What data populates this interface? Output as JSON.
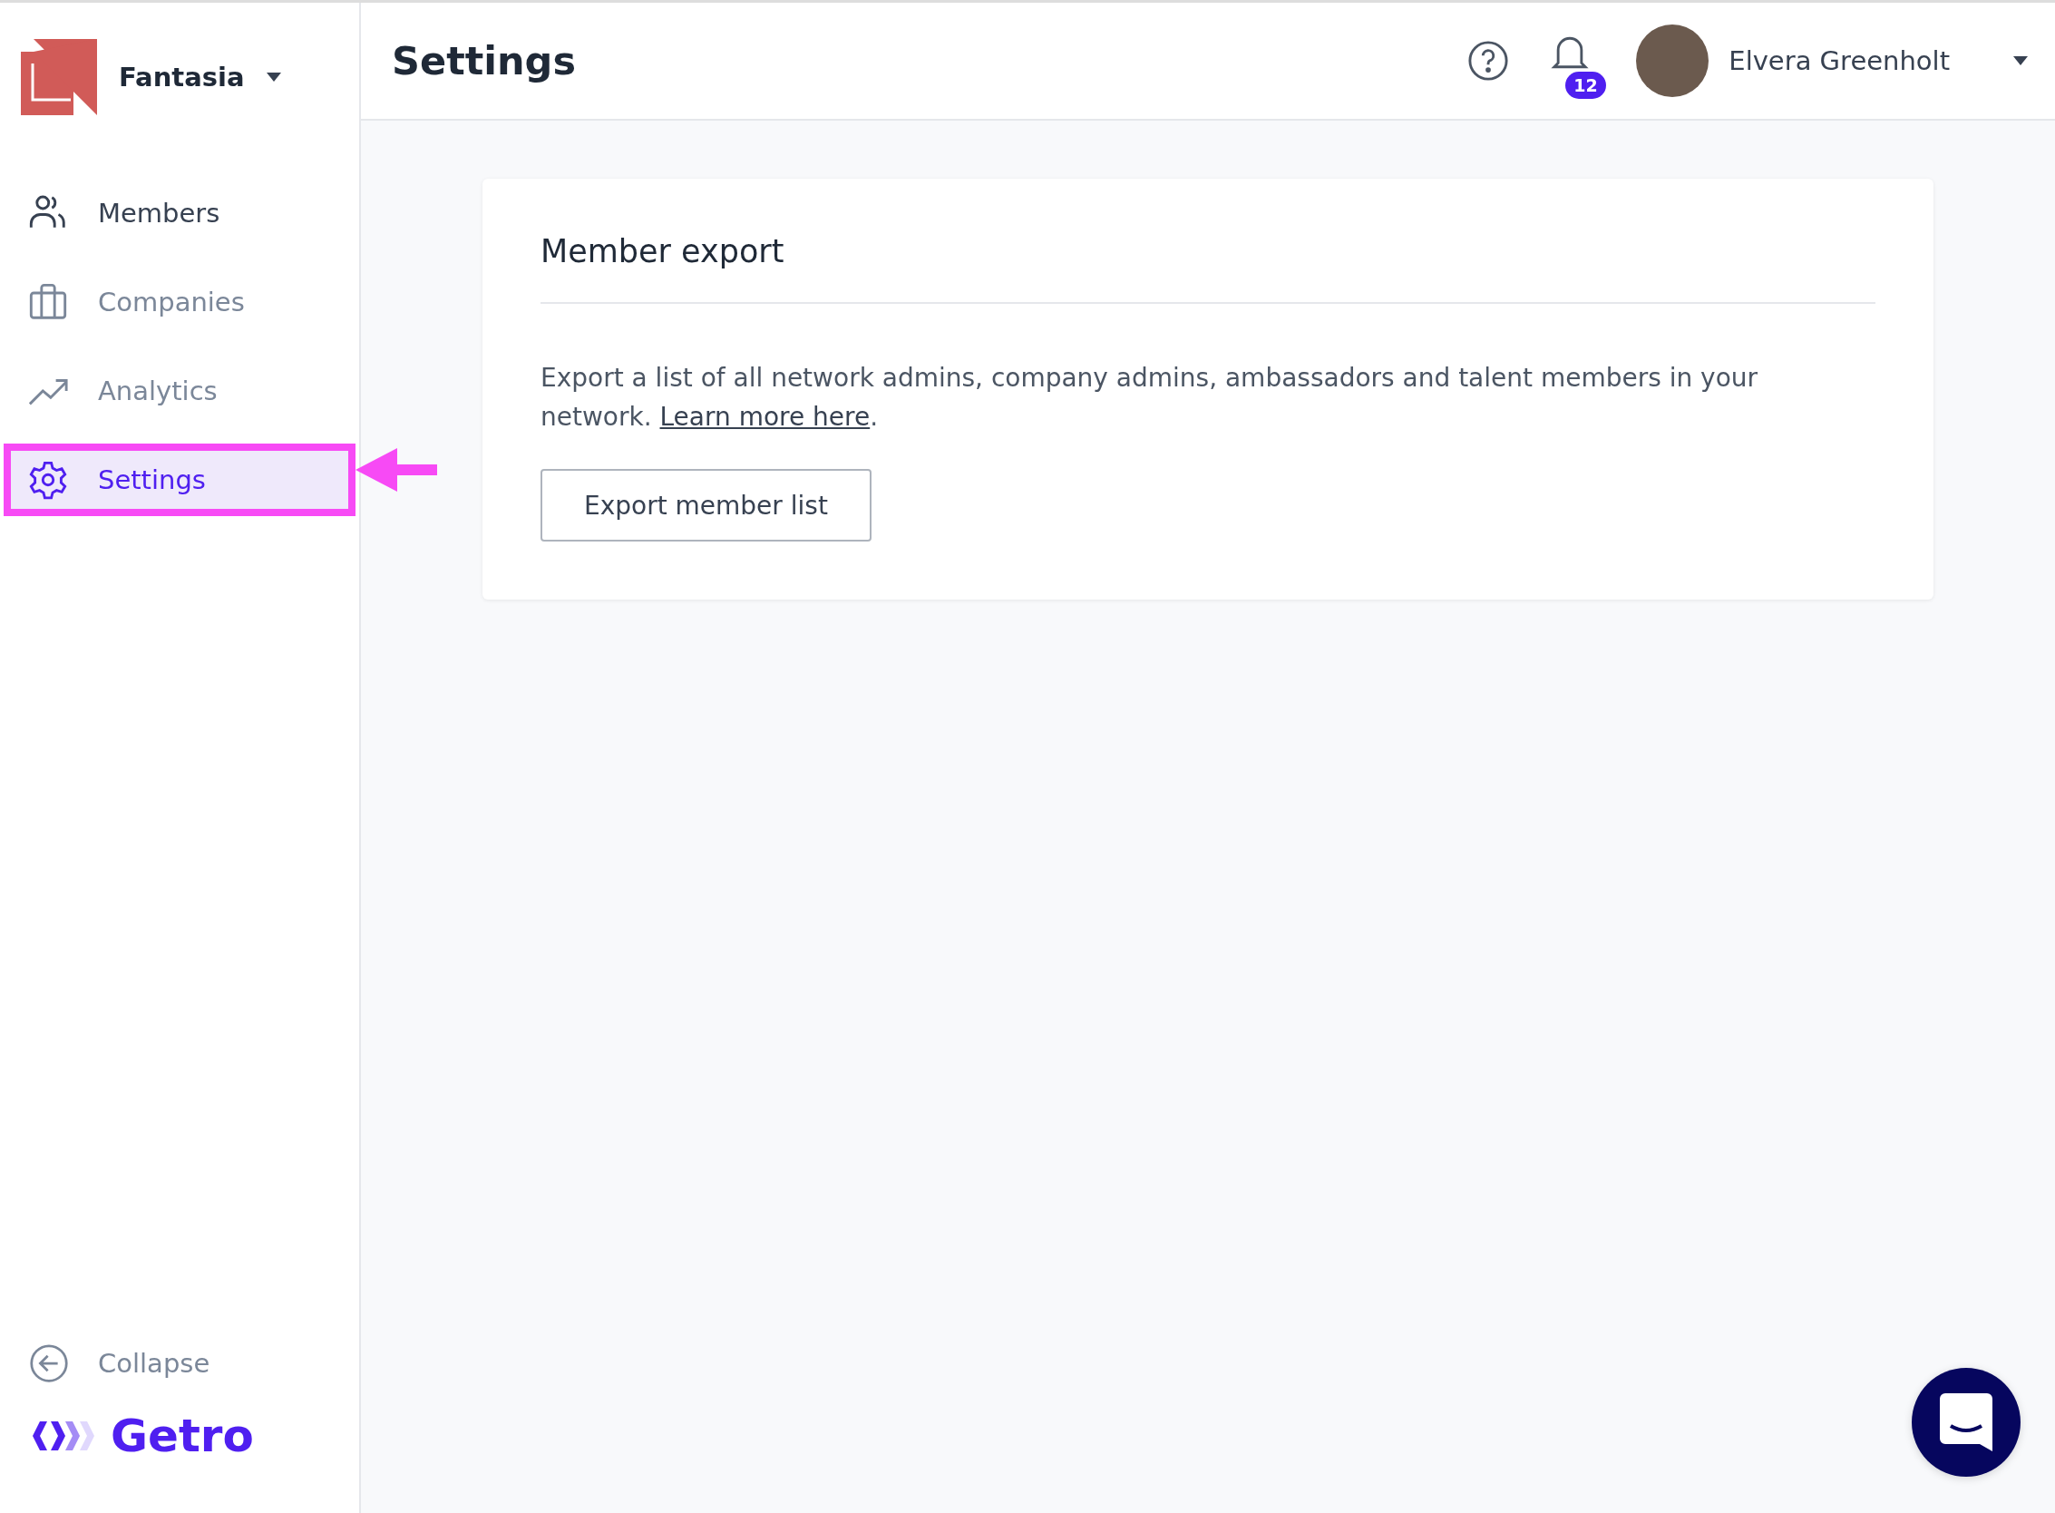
{
  "workspace": {
    "name": "Fantasia"
  },
  "nav": [
    {
      "label": "Members",
      "selected": false,
      "muted": false
    },
    {
      "label": "Companies",
      "selected": false,
      "muted": true
    },
    {
      "label": "Analytics",
      "selected": false,
      "muted": true
    },
    {
      "label": "Settings",
      "selected": true,
      "muted": false
    }
  ],
  "collapse": {
    "label": "Collapse"
  },
  "brand": {
    "name": "Getro"
  },
  "header": {
    "title": "Settings",
    "notification_count": "12",
    "user_name": "Elvera Greenholt"
  },
  "card": {
    "title": "Member export",
    "description": "Export a list of all network admins, company admins, ambassadors and talent members in your network.",
    "link": "Learn more here",
    "link_suffix": ".",
    "button": "Export member list"
  }
}
